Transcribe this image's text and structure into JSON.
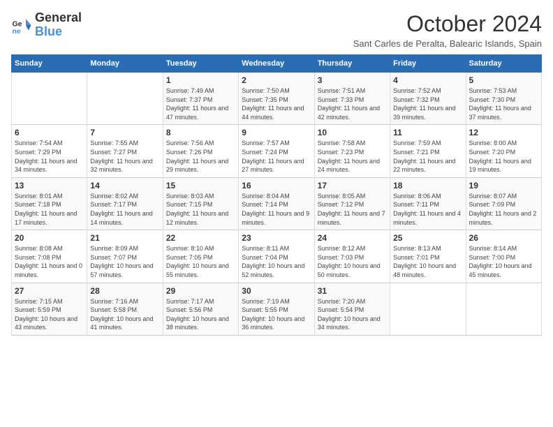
{
  "logo": {
    "general": "General",
    "blue": "Blue"
  },
  "title": "October 2024",
  "subtitle": "Sant Carles de Peralta, Balearic Islands, Spain",
  "weekdays": [
    "Sunday",
    "Monday",
    "Tuesday",
    "Wednesday",
    "Thursday",
    "Friday",
    "Saturday"
  ],
  "weeks": [
    [
      {
        "day": "",
        "info": ""
      },
      {
        "day": "",
        "info": ""
      },
      {
        "day": "1",
        "info": "Sunrise: 7:49 AM\nSunset: 7:37 PM\nDaylight: 11 hours and 47 minutes."
      },
      {
        "day": "2",
        "info": "Sunrise: 7:50 AM\nSunset: 7:35 PM\nDaylight: 11 hours and 44 minutes."
      },
      {
        "day": "3",
        "info": "Sunrise: 7:51 AM\nSunset: 7:33 PM\nDaylight: 11 hours and 42 minutes."
      },
      {
        "day": "4",
        "info": "Sunrise: 7:52 AM\nSunset: 7:32 PM\nDaylight: 11 hours and 39 minutes."
      },
      {
        "day": "5",
        "info": "Sunrise: 7:53 AM\nSunset: 7:30 PM\nDaylight: 11 hours and 37 minutes."
      }
    ],
    [
      {
        "day": "6",
        "info": "Sunrise: 7:54 AM\nSunset: 7:29 PM\nDaylight: 11 hours and 34 minutes."
      },
      {
        "day": "7",
        "info": "Sunrise: 7:55 AM\nSunset: 7:27 PM\nDaylight: 11 hours and 32 minutes."
      },
      {
        "day": "8",
        "info": "Sunrise: 7:56 AM\nSunset: 7:26 PM\nDaylight: 11 hours and 29 minutes."
      },
      {
        "day": "9",
        "info": "Sunrise: 7:57 AM\nSunset: 7:24 PM\nDaylight: 11 hours and 27 minutes."
      },
      {
        "day": "10",
        "info": "Sunrise: 7:58 AM\nSunset: 7:23 PM\nDaylight: 11 hours and 24 minutes."
      },
      {
        "day": "11",
        "info": "Sunrise: 7:59 AM\nSunset: 7:21 PM\nDaylight: 11 hours and 22 minutes."
      },
      {
        "day": "12",
        "info": "Sunrise: 8:00 AM\nSunset: 7:20 PM\nDaylight: 11 hours and 19 minutes."
      }
    ],
    [
      {
        "day": "13",
        "info": "Sunrise: 8:01 AM\nSunset: 7:18 PM\nDaylight: 11 hours and 17 minutes."
      },
      {
        "day": "14",
        "info": "Sunrise: 8:02 AM\nSunset: 7:17 PM\nDaylight: 11 hours and 14 minutes."
      },
      {
        "day": "15",
        "info": "Sunrise: 8:03 AM\nSunset: 7:15 PM\nDaylight: 11 hours and 12 minutes."
      },
      {
        "day": "16",
        "info": "Sunrise: 8:04 AM\nSunset: 7:14 PM\nDaylight: 11 hours and 9 minutes."
      },
      {
        "day": "17",
        "info": "Sunrise: 8:05 AM\nSunset: 7:12 PM\nDaylight: 11 hours and 7 minutes."
      },
      {
        "day": "18",
        "info": "Sunrise: 8:06 AM\nSunset: 7:11 PM\nDaylight: 11 hours and 4 minutes."
      },
      {
        "day": "19",
        "info": "Sunrise: 8:07 AM\nSunset: 7:09 PM\nDaylight: 11 hours and 2 minutes."
      }
    ],
    [
      {
        "day": "20",
        "info": "Sunrise: 8:08 AM\nSunset: 7:08 PM\nDaylight: 11 hours and 0 minutes."
      },
      {
        "day": "21",
        "info": "Sunrise: 8:09 AM\nSunset: 7:07 PM\nDaylight: 10 hours and 57 minutes."
      },
      {
        "day": "22",
        "info": "Sunrise: 8:10 AM\nSunset: 7:05 PM\nDaylight: 10 hours and 55 minutes."
      },
      {
        "day": "23",
        "info": "Sunrise: 8:11 AM\nSunset: 7:04 PM\nDaylight: 10 hours and 52 minutes."
      },
      {
        "day": "24",
        "info": "Sunrise: 8:12 AM\nSunset: 7:03 PM\nDaylight: 10 hours and 50 minutes."
      },
      {
        "day": "25",
        "info": "Sunrise: 8:13 AM\nSunset: 7:01 PM\nDaylight: 10 hours and 48 minutes."
      },
      {
        "day": "26",
        "info": "Sunrise: 8:14 AM\nSunset: 7:00 PM\nDaylight: 10 hours and 45 minutes."
      }
    ],
    [
      {
        "day": "27",
        "info": "Sunrise: 7:15 AM\nSunset: 5:59 PM\nDaylight: 10 hours and 43 minutes."
      },
      {
        "day": "28",
        "info": "Sunrise: 7:16 AM\nSunset: 5:58 PM\nDaylight: 10 hours and 41 minutes."
      },
      {
        "day": "29",
        "info": "Sunrise: 7:17 AM\nSunset: 5:56 PM\nDaylight: 10 hours and 38 minutes."
      },
      {
        "day": "30",
        "info": "Sunrise: 7:19 AM\nSunset: 5:55 PM\nDaylight: 10 hours and 36 minutes."
      },
      {
        "day": "31",
        "info": "Sunrise: 7:20 AM\nSunset: 5:54 PM\nDaylight: 10 hours and 34 minutes."
      },
      {
        "day": "",
        "info": ""
      },
      {
        "day": "",
        "info": ""
      }
    ]
  ]
}
